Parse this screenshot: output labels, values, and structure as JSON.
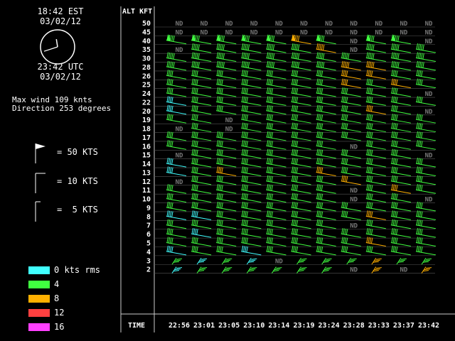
{
  "header": {
    "local_time": "18:42 EST",
    "local_date": "03/02/12",
    "utc_time": "23:42 UTC",
    "utc_date": "03/02/12"
  },
  "clock": {
    "hour": 11,
    "minute": 42
  },
  "stats": {
    "max_wind": "Max wind 109 knts",
    "direction": "Direction 253 degrees"
  },
  "barb_legend": [
    {
      "label": "= 50 KTS",
      "icon": "pennant-50-icon"
    },
    {
      "label": "= 10 KTS",
      "icon": "full-barb-10-icon"
    },
    {
      "label": "=  5 KTS",
      "icon": "half-barb-5-icon"
    }
  ],
  "color_legend": [
    {
      "label": "0 kts rms",
      "color": "#40ffff"
    },
    {
      "label": "4",
      "color": "#40ff40"
    },
    {
      "label": "8",
      "color": "#ffb000"
    },
    {
      "label": "12",
      "color": "#ff4040"
    },
    {
      "label": "16",
      "color": "#ff40ff"
    }
  ],
  "chart_data": {
    "type": "wind-profile",
    "ylabel": "ALT KFT",
    "xlabel": "TIME",
    "altitudes": [
      50,
      45,
      40,
      35,
      30,
      28,
      26,
      25,
      24,
      22,
      20,
      19,
      18,
      17,
      16,
      15,
      14,
      13,
      12,
      11,
      10,
      9,
      8,
      7,
      6,
      5,
      4,
      3,
      2
    ],
    "times": [
      "22:56",
      "23:01",
      "23:05",
      "23:10",
      "23:14",
      "23:19",
      "23:24",
      "23:28",
      "23:33",
      "23:37",
      "23:42"
    ],
    "nd_label": "ND",
    "nd_cells": [
      [
        0,
        0
      ],
      [
        0,
        1
      ],
      [
        0,
        2
      ],
      [
        0,
        3
      ],
      [
        0,
        4
      ],
      [
        0,
        5
      ],
      [
        0,
        6
      ],
      [
        0,
        7
      ],
      [
        0,
        8
      ],
      [
        0,
        9
      ],
      [
        0,
        10
      ],
      [
        1,
        0
      ],
      [
        1,
        1
      ],
      [
        1,
        2
      ],
      [
        1,
        3
      ],
      [
        1,
        4
      ],
      [
        1,
        5
      ],
      [
        1,
        6
      ],
      [
        1,
        7
      ],
      [
        1,
        8
      ],
      [
        1,
        9
      ],
      [
        1,
        10
      ],
      [
        2,
        7
      ],
      [
        2,
        10
      ],
      [
        3,
        0
      ],
      [
        3,
        7
      ],
      [
        8,
        10
      ],
      [
        10,
        10
      ],
      [
        11,
        2
      ],
      [
        12,
        0
      ],
      [
        12,
        2
      ],
      [
        14,
        7
      ],
      [
        15,
        0
      ],
      [
        15,
        10
      ],
      [
        18,
        0
      ],
      [
        19,
        7
      ],
      [
        20,
        7
      ],
      [
        20,
        10
      ],
      [
        23,
        7
      ],
      [
        27,
        4
      ],
      [
        28,
        7
      ],
      [
        28,
        9
      ],
      [
        29,
        10
      ],
      [
        30,
        7
      ],
      [
        30,
        8
      ],
      [
        31,
        10
      ]
    ],
    "rms_cells": [
      [
        [
          9,
          0
        ],
        [
          10,
          0
        ],
        [
          16,
          0
        ],
        [
          17,
          0
        ],
        [
          22,
          0
        ],
        [
          22,
          1
        ],
        [
          24,
          1
        ],
        [
          26,
          0
        ],
        [
          26,
          3
        ],
        [
          27,
          1
        ],
        [
          27,
          3
        ],
        [
          28,
          0
        ],
        [
          29,
          1
        ]
      ],
      [
        [
          2,
          5
        ],
        [
          3,
          6
        ],
        [
          5,
          7
        ],
        [
          5,
          8
        ],
        [
          6,
          7
        ],
        [
          6,
          8
        ],
        [
          7,
          7
        ],
        [
          7,
          9
        ],
        [
          10,
          8
        ],
        [
          17,
          2
        ],
        [
          17,
          6
        ],
        [
          18,
          7
        ],
        [
          19,
          9
        ],
        [
          22,
          8
        ],
        [
          25,
          8
        ],
        [
          27,
          8
        ],
        [
          28,
          8
        ],
        [
          28,
          10
        ],
        [
          29,
          6
        ],
        [
          30,
          8
        ]
      ]
    ]
  }
}
